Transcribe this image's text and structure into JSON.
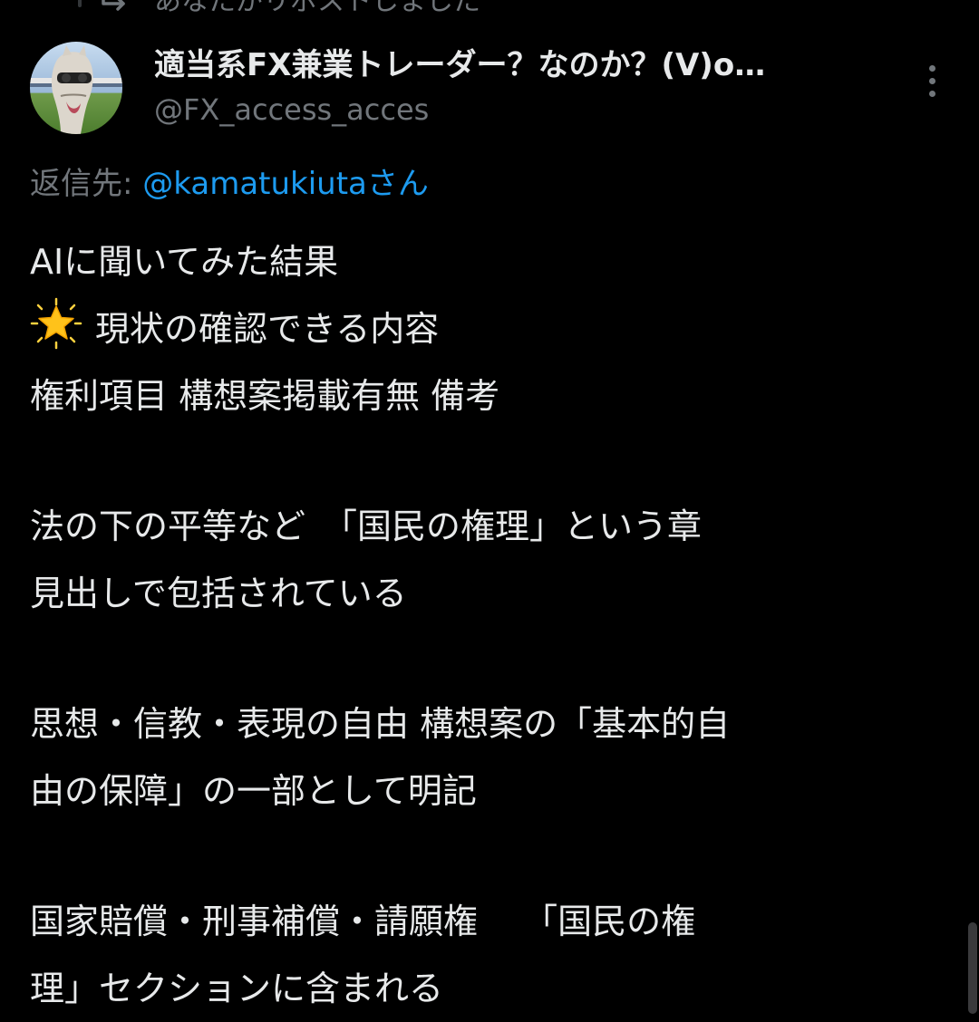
{
  "repost_banner": {
    "text": "あなたがリポストしました",
    "icon": "repost-icon"
  },
  "author": {
    "display_name": "適当系FX兼業トレーダー？なのか？(V)o…",
    "handle": "@FX_access_acces",
    "avatar": "horse-avatar"
  },
  "more_icon": "more-vertical-icon",
  "reply": {
    "label": "返信先: ",
    "user": "@kamatukiutaさん"
  },
  "post": {
    "lines": [
      "AIに聞いてみた結果",
      "現状の確認できる内容",
      "権利項目 構想案掲載有無 備考",
      "法の下の平等など　「国民の権理」という章",
      "見出しで包括されている",
      "思想・信教・表現の自由 構想案の「基本的自",
      "由の保障」の一部として明記",
      "国家賠償・刑事補償・請願権　 「国民の権",
      "理」セクションに含まれる"
    ],
    "star_icon": "glowing-star-icon"
  },
  "colors": {
    "background": "#000000",
    "text": "#e7e9ea",
    "muted": "#71767b",
    "link": "#1d9bf0"
  }
}
